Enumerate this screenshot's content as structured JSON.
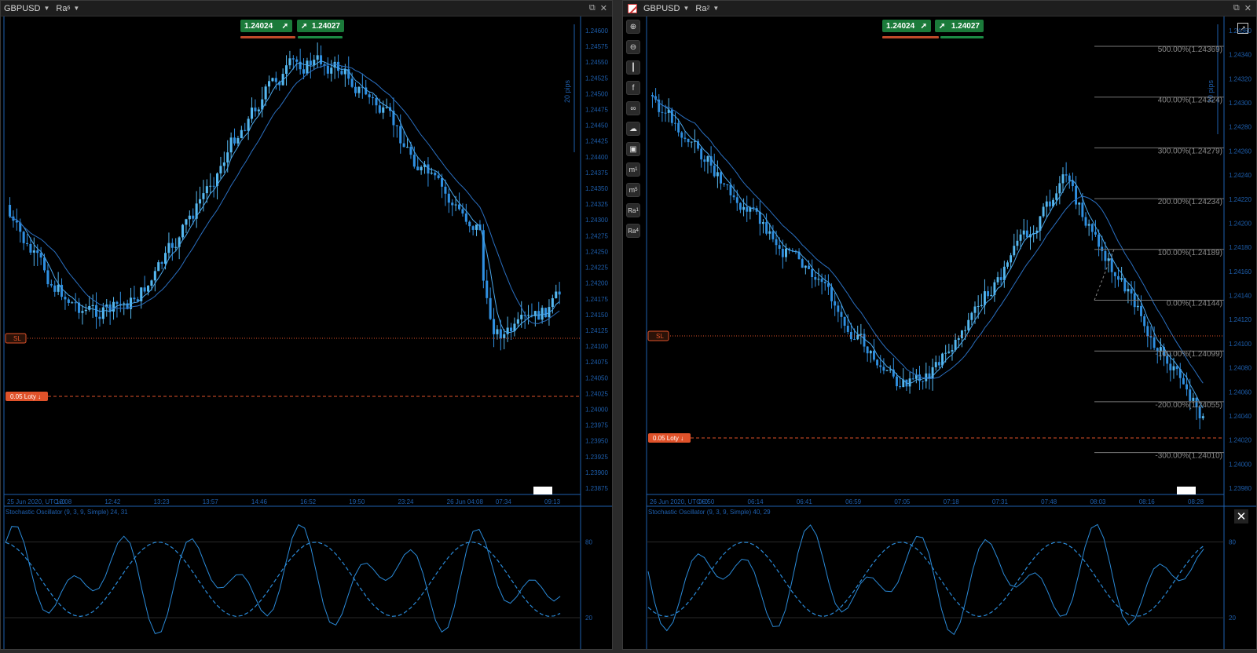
{
  "colors": {
    "bull": "#2f8fe0",
    "bear": "#55b8f0",
    "axis": "#1e5fae",
    "sl": "#e0522a",
    "quote_green": "#1b7a3a",
    "bar_red": "#c0492a",
    "bar_green": "#1c8a44"
  },
  "panels": [
    {
      "id": "left",
      "symbol": "GBPUSD",
      "timeframe": "Ra",
      "timeframe_sub": "6",
      "bid": "1.24024",
      "ask": "1.24027",
      "pips_label": "20 pips",
      "sl_label": "SL",
      "order_label": "0.05 Loty",
      "indicator_label": "Stochastic Oscillator (9, 3, 9, Simple) 24, 31",
      "price_ticks": [
        "1.24600",
        "1.24575",
        "1.24550",
        "1.24525",
        "1.24500",
        "1.24475",
        "1.24450",
        "1.24425",
        "1.24400",
        "1.24375",
        "1.24350",
        "1.24325",
        "1.24300",
        "1.24275",
        "1.24250",
        "1.24225",
        "1.24200",
        "1.24175",
        "1.24150",
        "1.24125",
        "1.24100",
        "1.24075",
        "1.24050",
        "1.24025",
        "1.24000",
        "1.23975",
        "1.23950",
        "1.23925",
        "1.23900",
        "1.23875"
      ],
      "time_ticks": [
        "25 Jun 2020, UTC+0",
        "12:08",
        "12:42",
        "13:23",
        "13:57",
        "14:46",
        "16:52",
        "19:50",
        "23:24",
        "26 Jun 04:08",
        "07:34",
        "09:13"
      ],
      "osc_ticks": [
        "80",
        "20"
      ]
    },
    {
      "id": "right",
      "symbol": "GBPUSD",
      "timeframe": "Ra",
      "timeframe_sub": "2",
      "bid": "1.24024",
      "ask": "1.24027",
      "pips_label": "10 pips",
      "sl_label": "SL",
      "order_label": "0.05 Loty",
      "indicator_label": "Stochastic Oscillator (9, 3, 9, Simple) 40, 29",
      "price_ticks": [
        "1.24360",
        "1.24340",
        "1.24320",
        "1.24300",
        "1.24280",
        "1.24260",
        "1.24240",
        "1.24220",
        "1.24200",
        "1.24180",
        "1.24160",
        "1.24140",
        "1.24120",
        "1.24100",
        "1.24080",
        "1.24060",
        "1.24040",
        "1.24020",
        "1.24000",
        "1.23980"
      ],
      "time_ticks": [
        "26 Jun 2020, UTC+0",
        "05:50",
        "06:14",
        "06:41",
        "06:59",
        "07:05",
        "07:18",
        "07:31",
        "07:48",
        "08:03",
        "08:16",
        "08:28"
      ],
      "osc_ticks": [
        "80",
        "20"
      ],
      "fib_levels": [
        "500.00%(1.24369)",
        "400.00%(1.24324)",
        "300.00%(1.24279)",
        "200.00%(1.24234)",
        "100.00%(1.24189)",
        "0.00%(1.24144)",
        "-100.00%(1.24099)",
        "-200.00%(1.24055)",
        "-300.00%(1.24010)"
      ],
      "tools": [
        "zoom-in",
        "zoom-out",
        "bar-style",
        "circle-f",
        "link",
        "cloud",
        "screenshot",
        "m1",
        "m5",
        "Ra1",
        "Ra4"
      ]
    }
  ]
}
